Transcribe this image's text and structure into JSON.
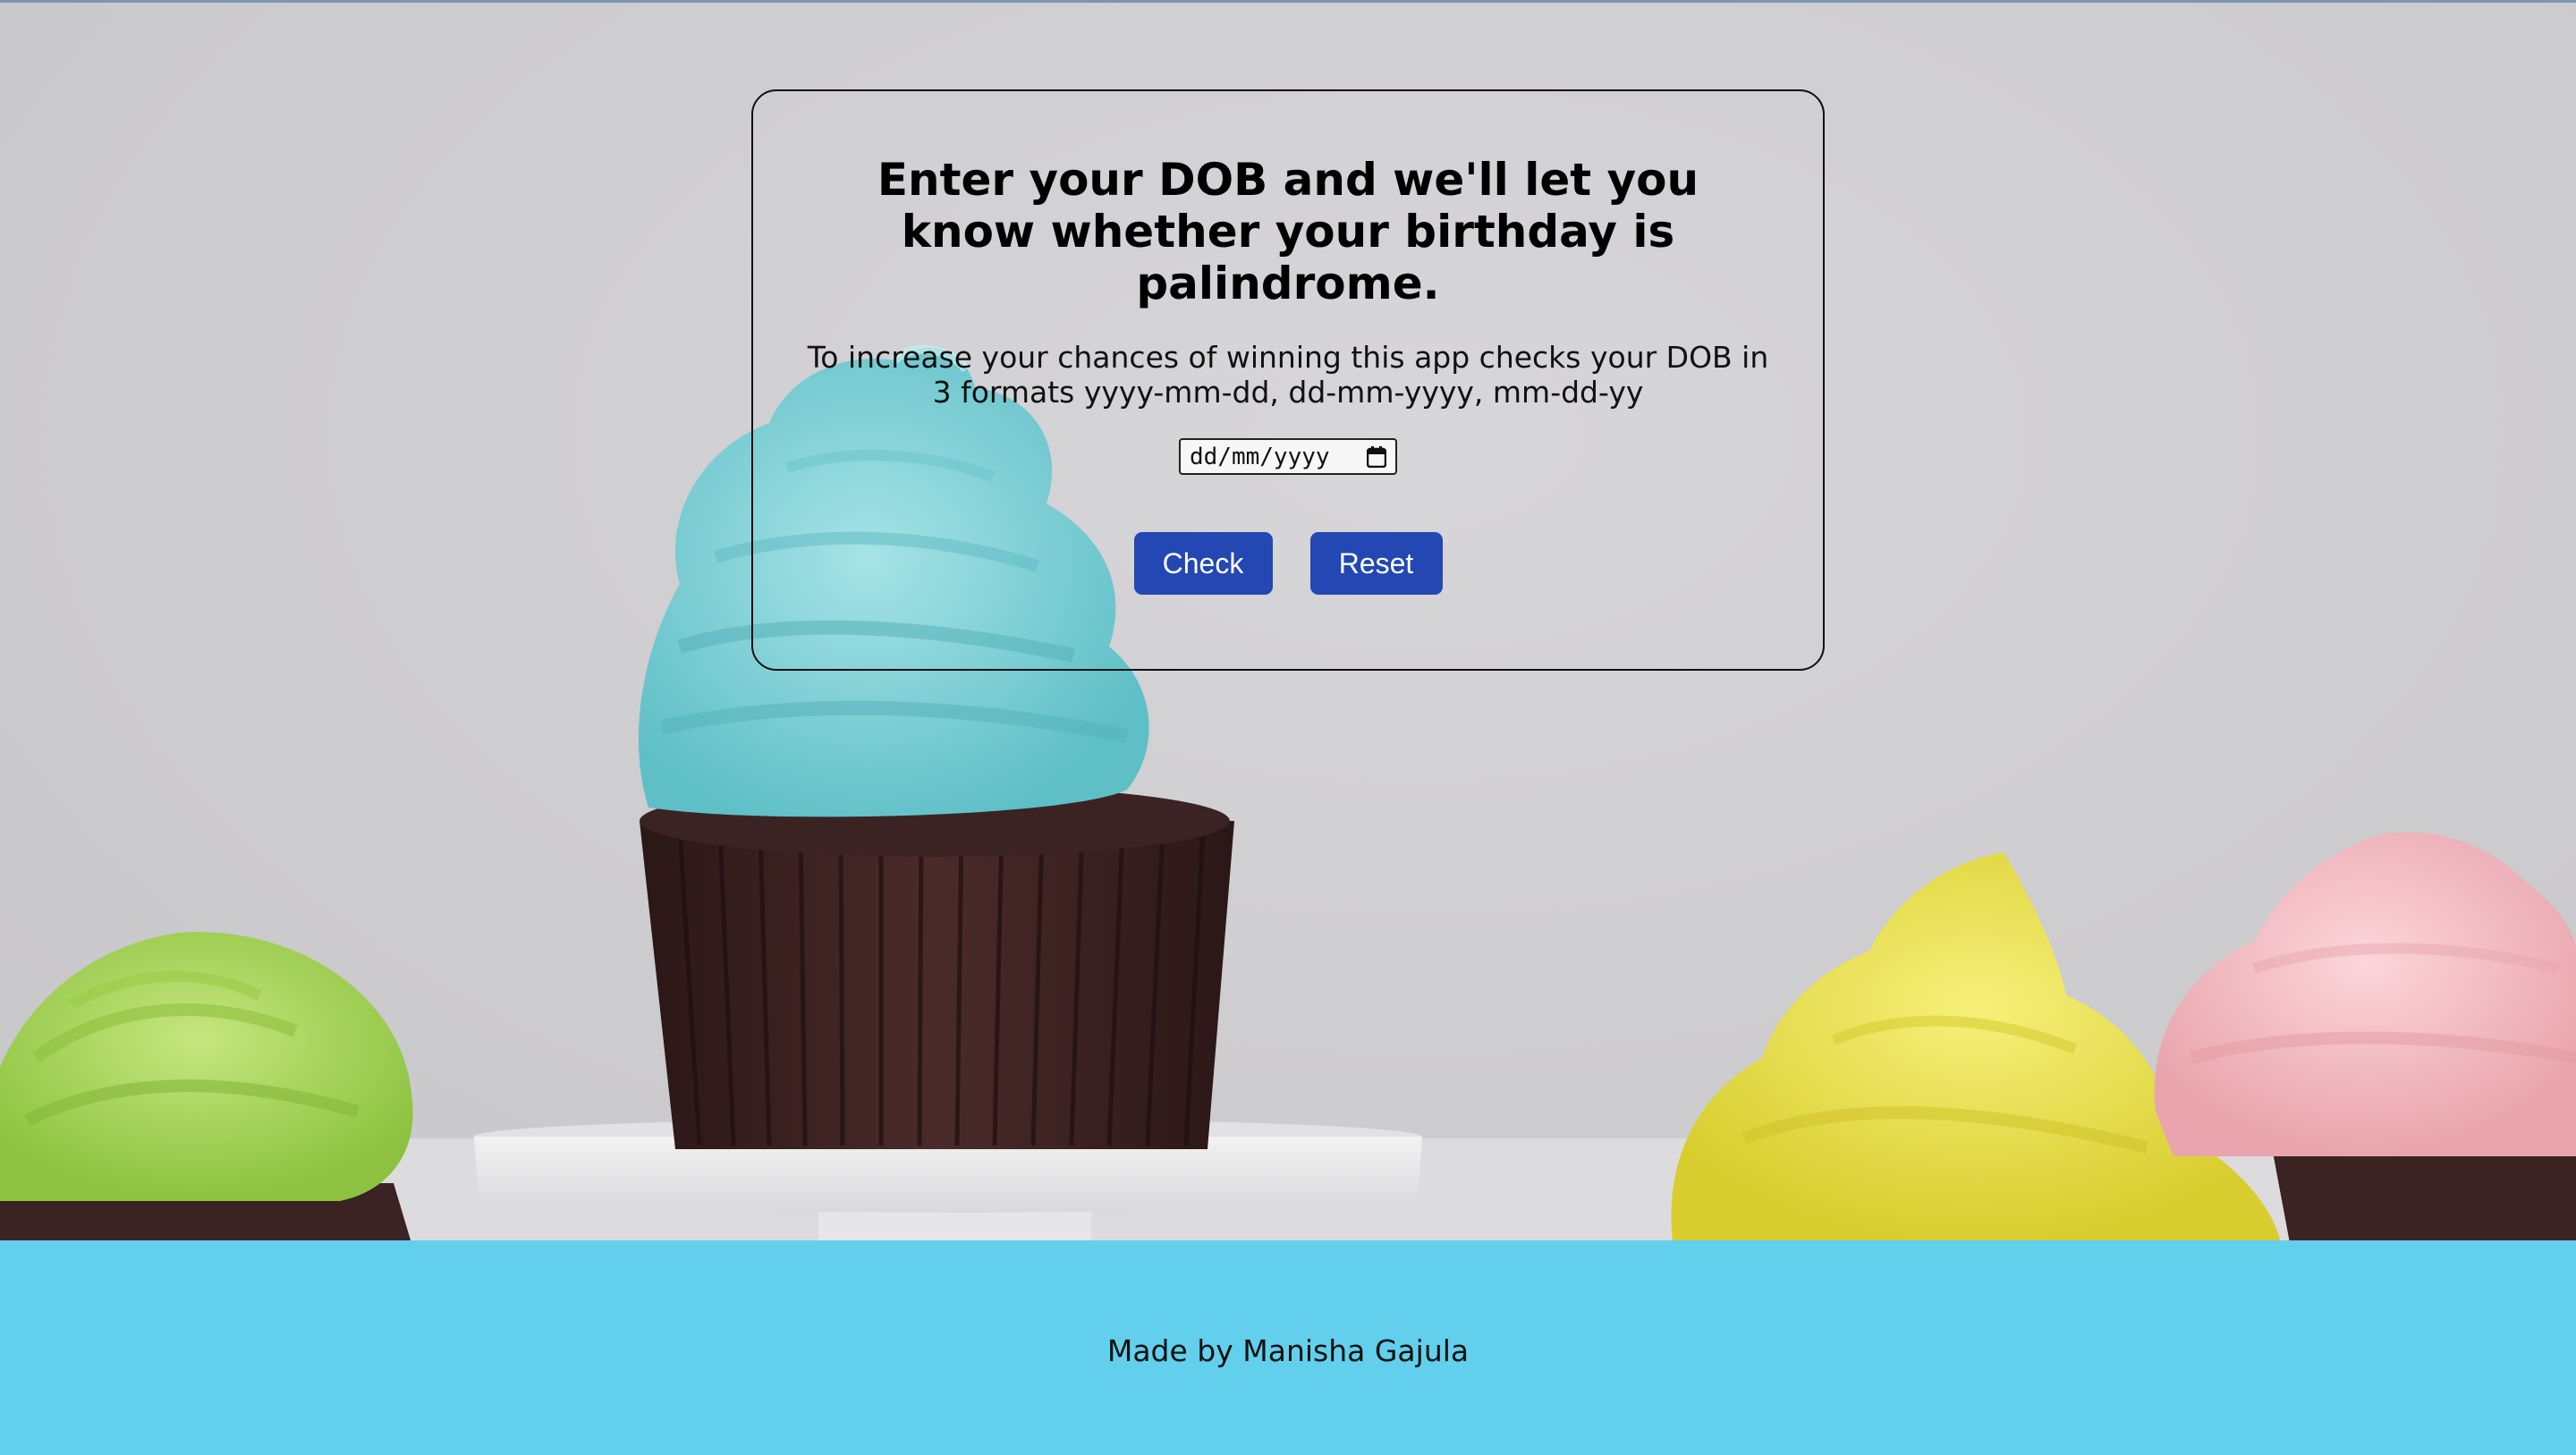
{
  "card": {
    "heading": "Enter your DOB and we'll let you know whether your birthday is palindrome.",
    "description": "To increase your chances of winning this app checks your DOB in 3 formats yyyy-mm-dd, dd-mm-yyyy, mm-dd-yy",
    "date_placeholder": "dd/mm/yyyy",
    "check_label": "Check",
    "reset_label": "Reset"
  },
  "footer": {
    "credit": "Made by Manisha Gajula"
  },
  "background": {
    "image": "cupcakes-photo",
    "colors": {
      "backdrop": "#cfced0",
      "frosting_blue": "#7fd3d8",
      "frosting_green": "#a7d35a",
      "frosting_yellow": "#ece24e",
      "frosting_pink": "#f3bcc2",
      "chocolate": "#3a2322",
      "cake_stand": "#e9e9eb"
    }
  },
  "theme": {
    "button_color": "#2347b3",
    "footer_color": "#62d0ec"
  },
  "icons": {
    "date_picker": "calendar-icon"
  }
}
